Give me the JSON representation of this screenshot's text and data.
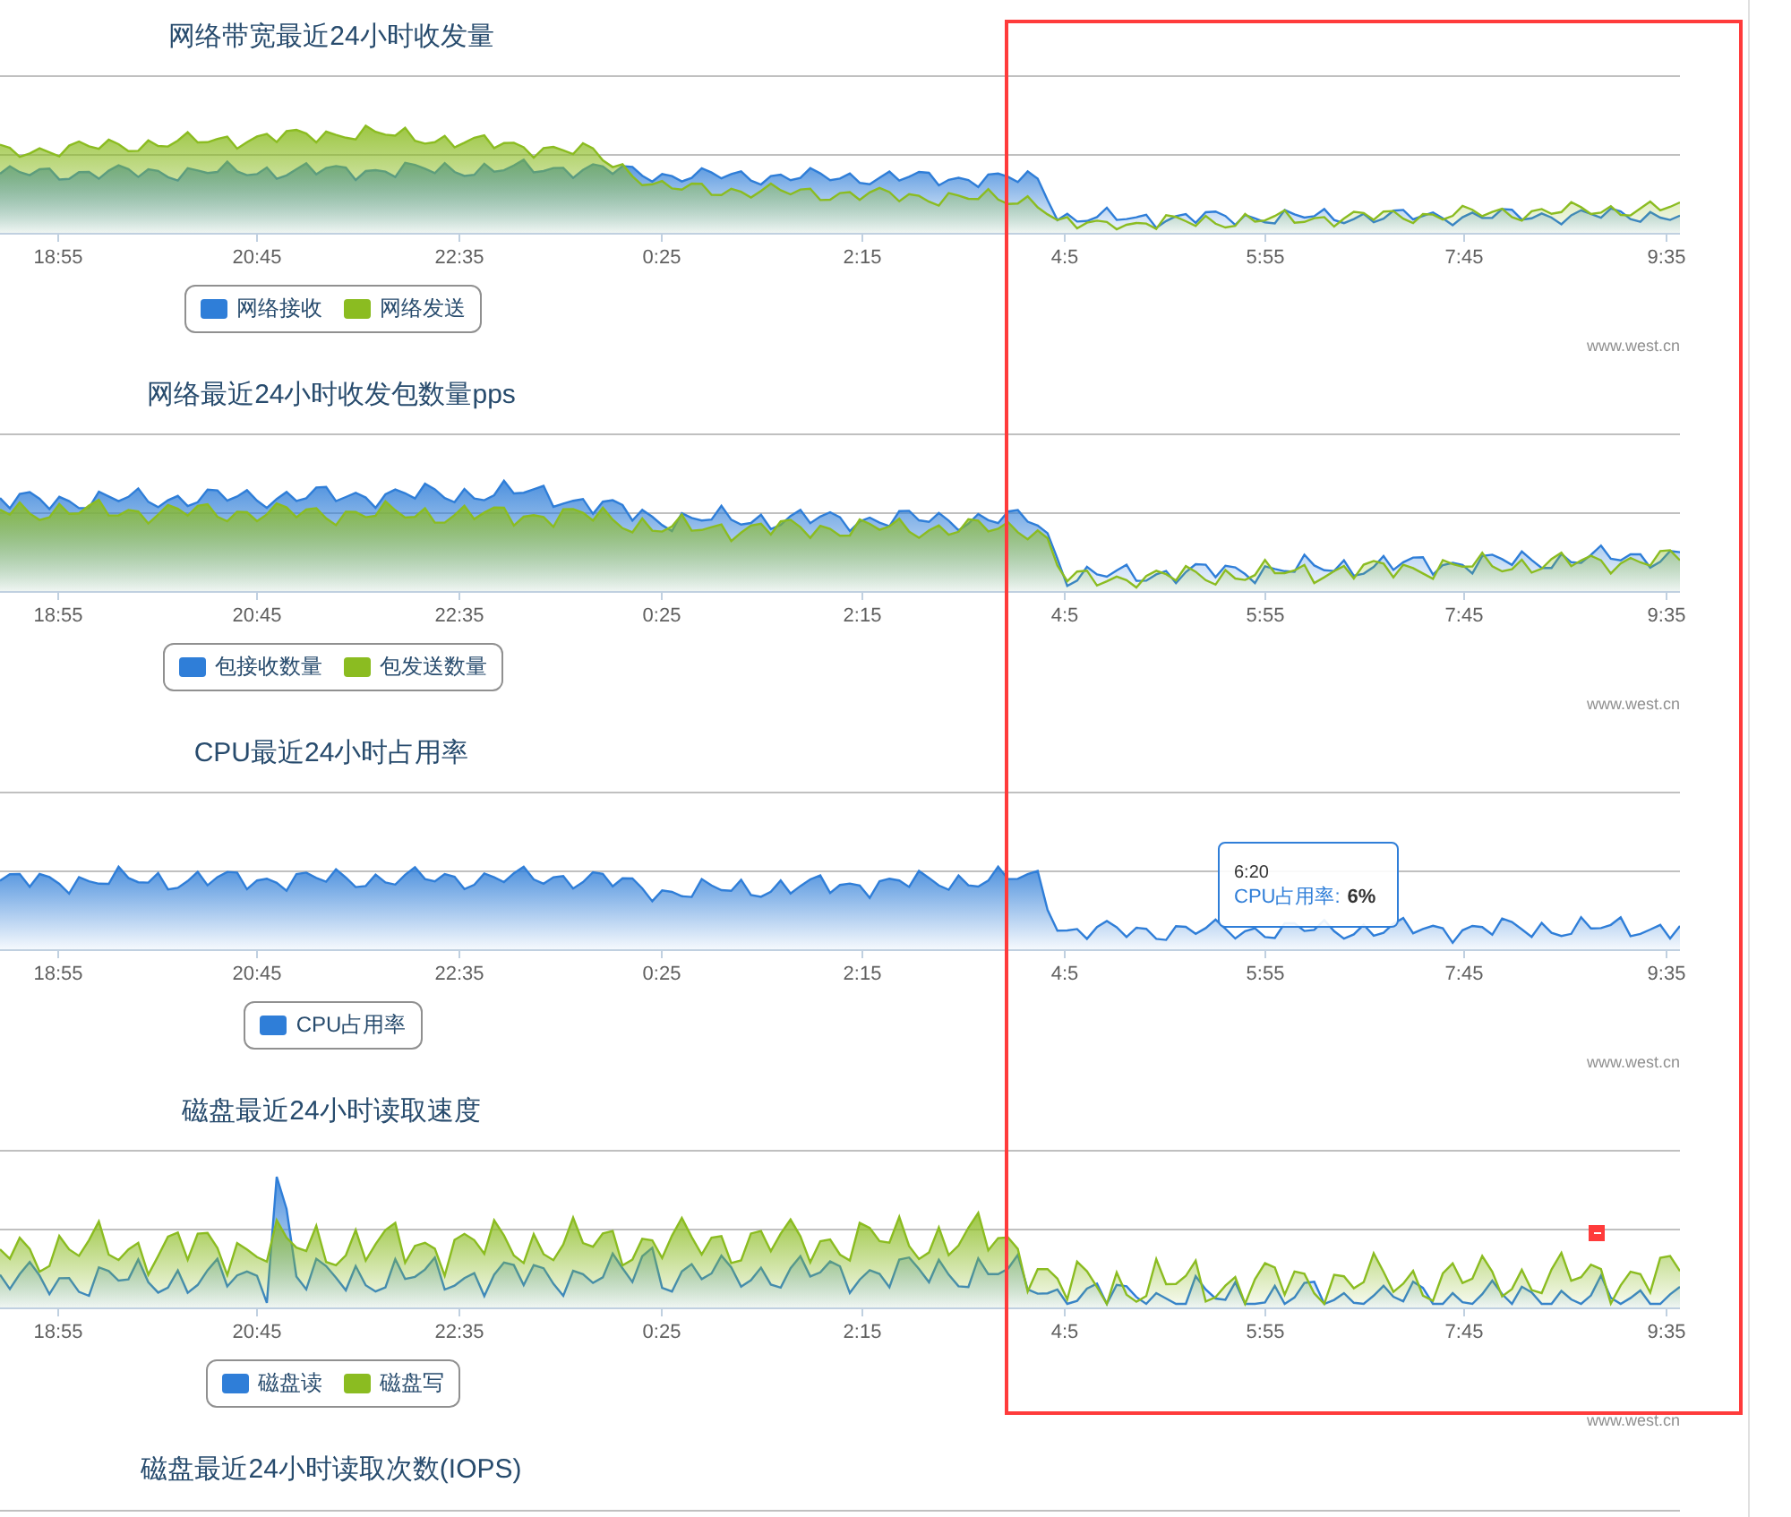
{
  "charts": [
    {
      "title": "网络带宽最近24小时收发量",
      "xticks": [
        "18:55",
        "20:45",
        "22:35",
        "0:25",
        "2:15",
        "4:5",
        "5:55",
        "7:45",
        "9:35"
      ],
      "legend": [
        {
          "label": "网络接收",
          "color": "#2f7ed8"
        },
        {
          "label": "网络发送",
          "color": "#8bbc21"
        }
      ],
      "credit": "www.west.cn"
    },
    {
      "title": "网络最近24小时收发包数量pps",
      "xticks": [
        "18:55",
        "20:45",
        "22:35",
        "0:25",
        "2:15",
        "4:5",
        "5:55",
        "7:45",
        "9:35"
      ],
      "legend": [
        {
          "label": "包接收数量",
          "color": "#2f7ed8"
        },
        {
          "label": "包发送数量",
          "color": "#8bbc21"
        }
      ],
      "credit": "www.west.cn"
    },
    {
      "title": "CPU最近24小时占用率",
      "xticks": [
        "18:55",
        "20:45",
        "22:35",
        "0:25",
        "2:15",
        "4:5",
        "5:55",
        "7:45",
        "9:35"
      ],
      "legend": [
        {
          "label": "CPU占用率",
          "color": "#2f7ed8"
        }
      ],
      "credit": "www.west.cn",
      "tooltip": {
        "time": "6:20",
        "label": "CPU占用率:",
        "value": "6%"
      }
    },
    {
      "title": "磁盘最近24小时读取速度",
      "xticks": [
        "18:55",
        "20:45",
        "22:35",
        "0:25",
        "2:15",
        "4:5",
        "5:55",
        "7:45",
        "9:35"
      ],
      "legend": [
        {
          "label": "磁盘读",
          "color": "#2f7ed8"
        },
        {
          "label": "磁盘写",
          "color": "#8bbc21"
        }
      ],
      "credit": "www.west.cn"
    },
    {
      "title": "磁盘最近24小时读取次数(IOPS)"
    }
  ]
}
